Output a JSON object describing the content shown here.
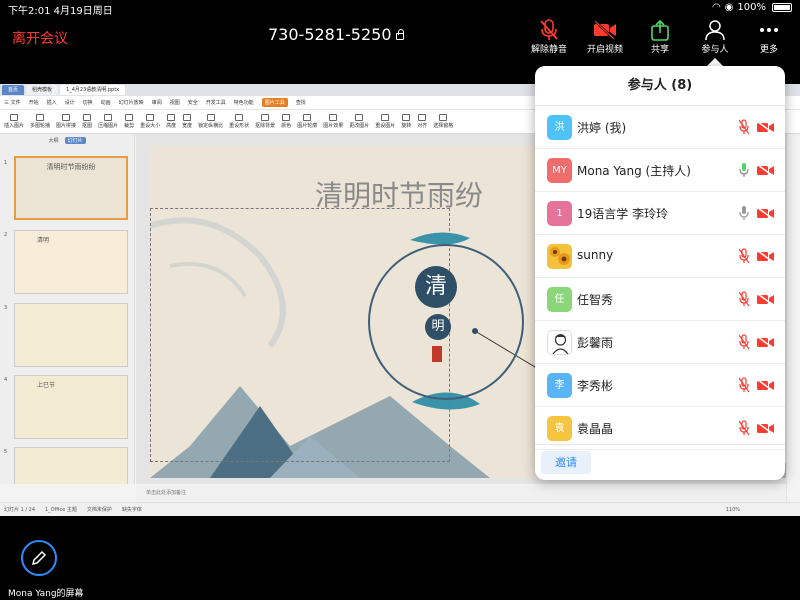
{
  "statusbar": {
    "time_date": "下午2:01   4月19日周日",
    "battery": "100%"
  },
  "header": {
    "leave_label": "离开会议",
    "meeting_id": "730-5281-5250"
  },
  "toolbar": {
    "unmute": "解除静音",
    "start_video": "开启视频",
    "share": "共享",
    "participants": "参与人",
    "more": "更多"
  },
  "wps": {
    "tabs": [
      "首页",
      "稻壳模板",
      "1_4月23语教清明.pptx"
    ],
    "menu": [
      "三 文件",
      "开始",
      "插入",
      "设计",
      "切换",
      "动画",
      "幻灯片放映",
      "审阅",
      "视图",
      "安全",
      "开发工具",
      "特色功能",
      "图片工具",
      "查找"
    ],
    "tools": [
      "插入图片",
      "多图轮播",
      "图片拼接",
      "抠图",
      "压缩图片",
      "裁剪",
      "重设大小",
      "高度",
      "宽度",
      "锁定纵横比",
      "重设形状",
      "抠除背景",
      "颜色",
      "图片轮廓",
      "图片效果",
      "更改图片",
      "重设图片",
      "旋转",
      "对齐",
      "选择窗格"
    ],
    "thumb_head": [
      "大纲",
      "幻灯片"
    ],
    "thumbs": [
      {
        "num": "1",
        "title": "清明时节雨纷纷"
      },
      {
        "num": "2",
        "title": "清明"
      },
      {
        "num": "3",
        "title": ""
      },
      {
        "num": "4",
        "title": "上巳节"
      },
      {
        "num": "5",
        "title": ""
      }
    ],
    "slide": {
      "title": "清明时节雨纷",
      "logo_top": "清",
      "logo_bottom": "明"
    },
    "notes_hint": "单击此处添加备注",
    "status": [
      "幻灯片 1 / 24",
      "1_Office 主题",
      "文档未保护",
      "缺失字体"
    ],
    "zoom": "110%"
  },
  "participants_panel": {
    "title": "参与人 (8)",
    "invite_label": "邀请",
    "people": [
      {
        "initial": "洪",
        "name": "洪婷 (我)",
        "color": "#4fc3f7",
        "mic": "muted",
        "video": "off"
      },
      {
        "initial": "MY",
        "name": "Mona Yang (主持人)",
        "color": "#ef6c6c",
        "mic": "on",
        "video": "off"
      },
      {
        "initial": "1",
        "name": "19语言学 李玲玲",
        "color": "#e57399",
        "mic": "idle",
        "video": "off"
      },
      {
        "initial": "",
        "name": "sunny",
        "color": "#f3c13a",
        "mic": "muted",
        "video": "off"
      },
      {
        "initial": "任",
        "name": "任智秀",
        "color": "#8bd67a",
        "mic": "muted",
        "video": "off"
      },
      {
        "initial": "",
        "name": "彭馨雨",
        "color": "#ffffff",
        "mic": "muted",
        "video": "off"
      },
      {
        "initial": "李",
        "name": "李秀彬",
        "color": "#5ab3f5",
        "mic": "muted",
        "video": "off"
      },
      {
        "initial": "袁",
        "name": "袁晶晶",
        "color": "#f5c542",
        "mic": "muted",
        "video": "off"
      }
    ]
  },
  "share": {
    "label": "Mona Yang的屏幕"
  },
  "colors": {
    "accent": "#2d8cff",
    "danger": "#ff3b30",
    "share_green": "#4cd964"
  }
}
